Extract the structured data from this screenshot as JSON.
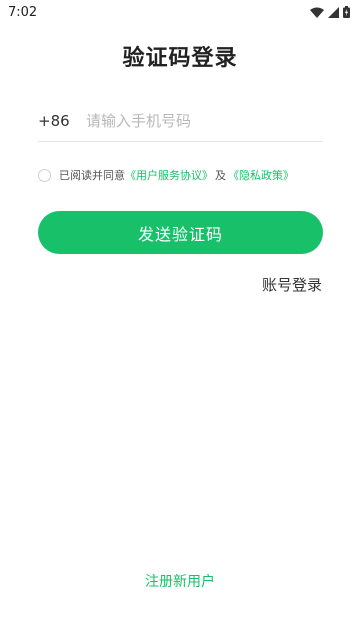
{
  "status_bar": {
    "time": "7:02",
    "icons": [
      "wifi-icon",
      "signal-icon",
      "battery-icon"
    ]
  },
  "page": {
    "title": "验证码登录"
  },
  "phone": {
    "country_code": "+86",
    "placeholder": "请输入手机号码",
    "value": ""
  },
  "agreement": {
    "prefix": "已阅读并同意",
    "user_agreement": "《用户服务协议》",
    "conjunction": "及",
    "privacy_policy": "《隐私政策》",
    "checked": false
  },
  "actions": {
    "send_code": "发送验证码",
    "account_login": "账号登录",
    "register": "注册新用户"
  },
  "colors": {
    "accent": "#19c06a",
    "text": "#222222",
    "placeholder": "#b8b8b8"
  }
}
